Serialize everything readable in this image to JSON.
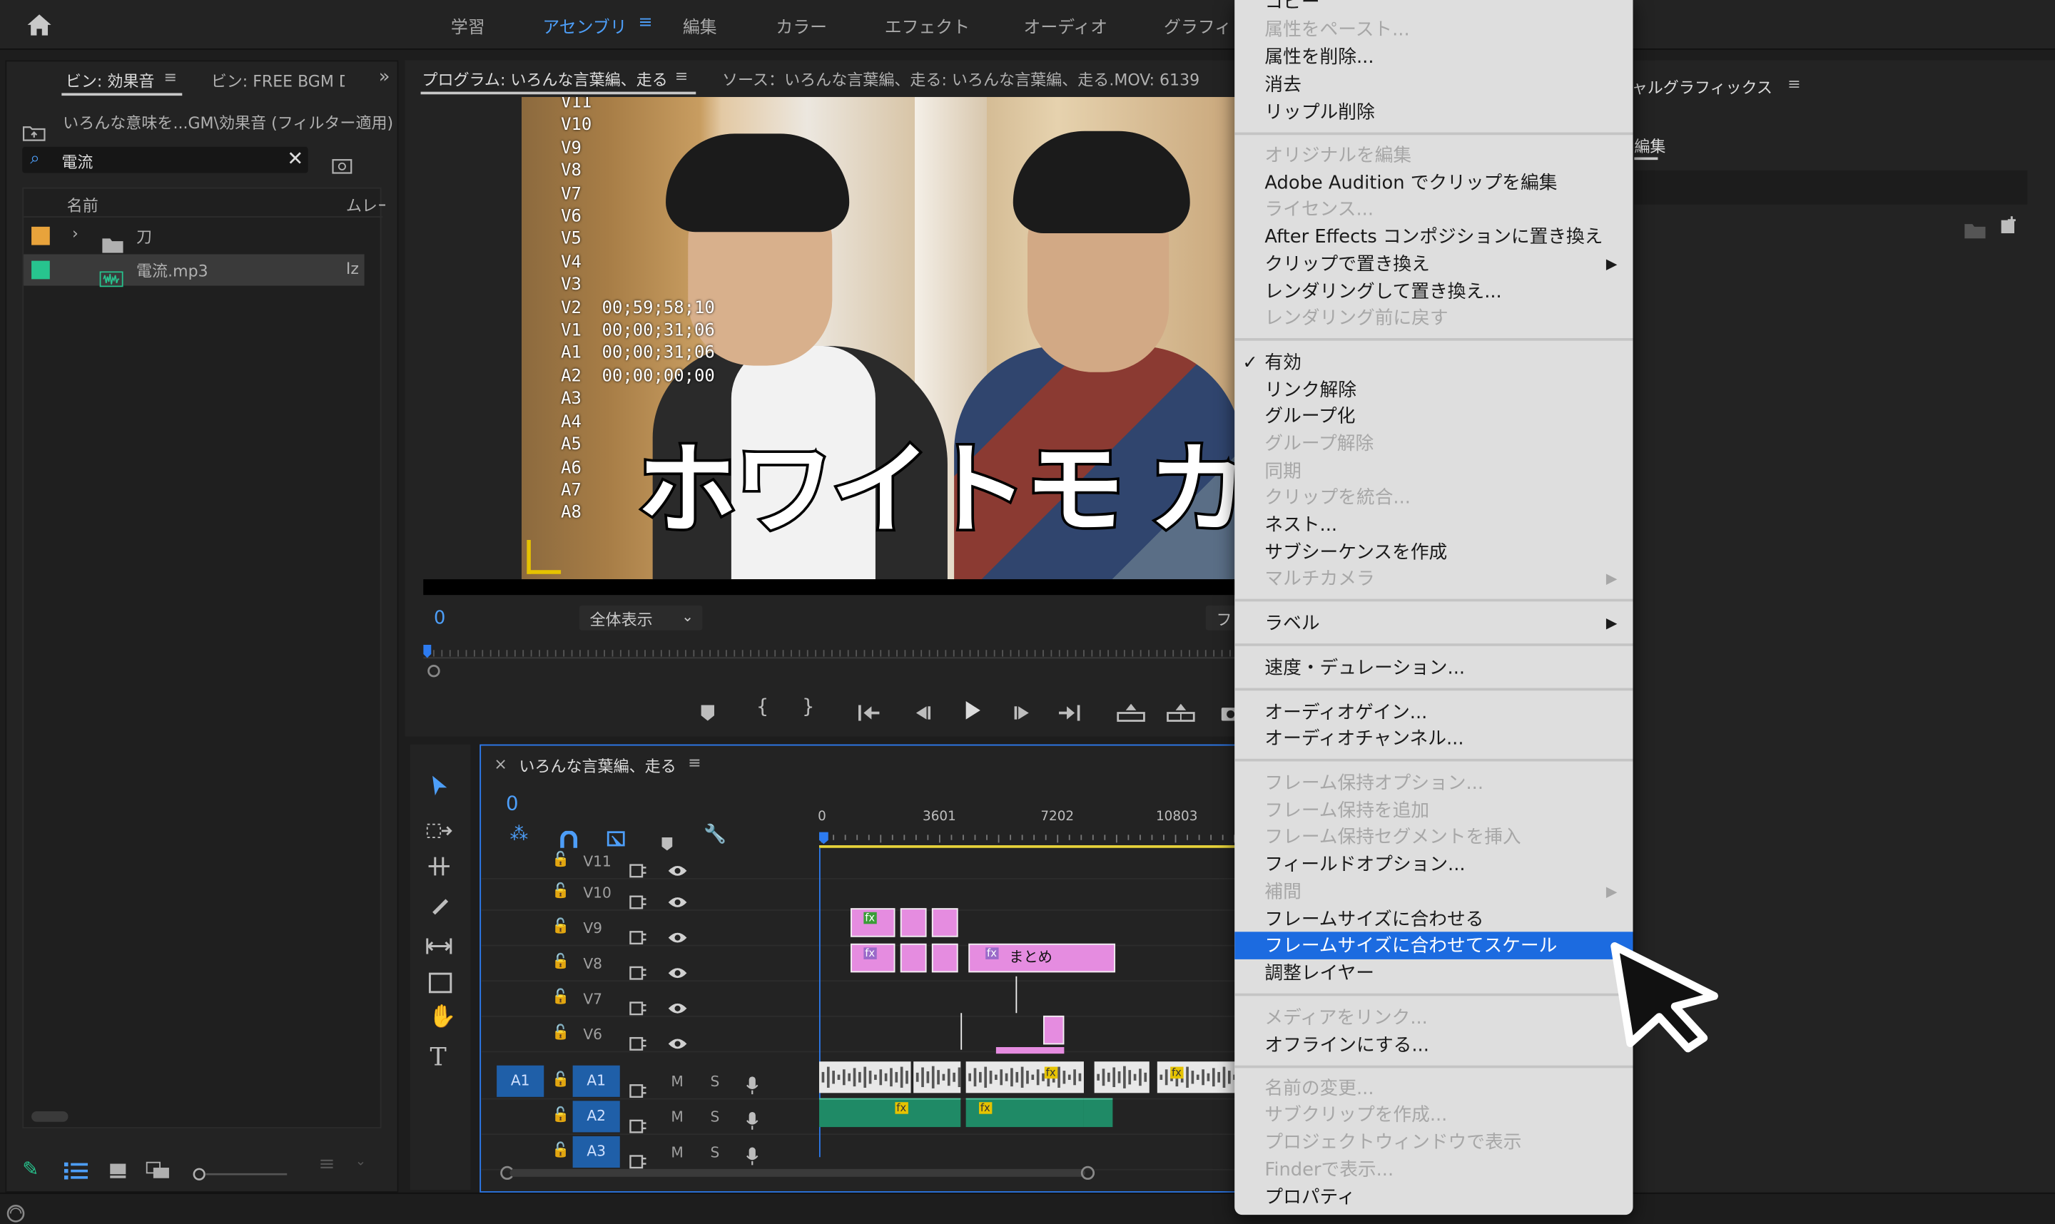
{
  "topbar": {
    "workspaces": [
      "学習",
      "アセンブリ",
      "編集",
      "カラー",
      "エフェクト",
      "オーディオ",
      "グラフィ"
    ],
    "active_index": 1
  },
  "project": {
    "tab_bin_effects": "ビン: 効果音",
    "tab_bin_bgm": "ビン: FREE BGM DO\\",
    "breadcrumb": "いろんな意味を...GM\\効果音 (フィルター適用)",
    "search_value": "電流",
    "col_name": "名前",
    "col_frame": "ムレー",
    "items": [
      {
        "label": "刀",
        "color": "#e8a33b",
        "type": "folder"
      },
      {
        "label": "電流.mp3",
        "color": "#27c48e",
        "type": "audio",
        "extra": "Iz"
      }
    ]
  },
  "program": {
    "tab_program": "プログラム: いろんな言葉編、走る",
    "tab_source": "ソース：いろんな言葉編、走る: いろんな言葉編、走る.MOV: 6139",
    "timecode": "0",
    "zoom": "全体表示",
    "fit_partial": "フ",
    "overlay_lines": [
      "V11",
      "V10",
      "V9",
      "V8",
      "V7",
      "V6",
      "V5",
      "V4",
      "V3",
      "V2  00;59;58;10",
      "V1  00;00;31;06",
      "A1  00;00;31;06",
      "A2  00;00;00;00",
      "A3",
      "A4",
      "A5",
      "A6",
      "A7",
      "A8"
    ],
    "caption": "ホワイトモ",
    "caption_partial": "カ"
  },
  "right_panel": {
    "title_partial": "ャルグラフィックス",
    "tab_partial": "編集"
  },
  "timeline": {
    "close": "×",
    "title": "いろんな言葉編、走る",
    "timecode": "0",
    "ruler": [
      "0",
      "3601",
      "7202",
      "10803"
    ],
    "video_tracks": [
      "V11",
      "V10",
      "V9",
      "V8",
      "V7",
      "V6"
    ],
    "audio_tracks": [
      {
        "src": "A1",
        "name": "A1"
      },
      {
        "src": "",
        "name": "A2"
      },
      {
        "src": "",
        "name": "A3"
      }
    ],
    "clip_label": "まとめ",
    "fx": "fx",
    "m": "M",
    "s": "S"
  },
  "context_menu": {
    "items": [
      {
        "label": "コピー",
        "enabled": true
      },
      {
        "label": "属性をペースト...",
        "enabled": false
      },
      {
        "label": "属性を削除...",
        "enabled": true
      },
      {
        "label": "消去",
        "enabled": true
      },
      {
        "label": "リップル削除",
        "enabled": true
      },
      {
        "label": "オリジナルを編集",
        "enabled": false
      },
      {
        "label": "Adobe Audition でクリップを編集",
        "enabled": true
      },
      {
        "label": "ライセンス...",
        "enabled": false
      },
      {
        "label": "After Effects コンポジションに置き換え",
        "enabled": true
      },
      {
        "label": "クリップで置き換え",
        "enabled": true,
        "submenu": true
      },
      {
        "label": "レンダリングして置き換え...",
        "enabled": true
      },
      {
        "label": "レンダリング前に戻す",
        "enabled": false
      },
      {
        "label": "有効",
        "enabled": true,
        "checked": true
      },
      {
        "label": "リンク解除",
        "enabled": true
      },
      {
        "label": "グループ化",
        "enabled": true
      },
      {
        "label": "グループ解除",
        "enabled": false
      },
      {
        "label": "同期",
        "enabled": false
      },
      {
        "label": "クリップを統合...",
        "enabled": false
      },
      {
        "label": "ネスト...",
        "enabled": true
      },
      {
        "label": "サブシーケンスを作成",
        "enabled": true
      },
      {
        "label": "マルチカメラ",
        "enabled": false,
        "submenu": true
      },
      {
        "label": "ラベル",
        "enabled": true,
        "submenu": true
      },
      {
        "label": "速度・デュレーション...",
        "enabled": true
      },
      {
        "label": "オーディオゲイン...",
        "enabled": true
      },
      {
        "label": "オーディオチャンネル...",
        "enabled": true
      },
      {
        "label": "フレーム保持オプション...",
        "enabled": false
      },
      {
        "label": "フレーム保持を追加",
        "enabled": false
      },
      {
        "label": "フレーム保持セグメントを挿入",
        "enabled": false
      },
      {
        "label": "フィールドオプション...",
        "enabled": true
      },
      {
        "label": "補間",
        "enabled": false,
        "submenu": true
      },
      {
        "label": "フレームサイズに合わせる",
        "enabled": true
      },
      {
        "label": "フレームサイズに合わせてスケール",
        "enabled": true,
        "highlighted": true
      },
      {
        "label": "調整レイヤー",
        "enabled": true
      },
      {
        "label": "メディアをリンク...",
        "enabled": false
      },
      {
        "label": "オフラインにする...",
        "enabled": true
      },
      {
        "label": "名前の変更...",
        "enabled": false
      },
      {
        "label": "サブクリップを作成...",
        "enabled": false
      },
      {
        "label": "プロジェクトウィンドウで表示",
        "enabled": false
      },
      {
        "label": "Finderで表示...",
        "enabled": false
      },
      {
        "label": "プロパティ",
        "enabled": true
      }
    ]
  },
  "colors": {
    "accent": "#4d9ef8",
    "menu_highlight": "#1c6be0",
    "playhead": "#2d7bf0",
    "work_area": "#e6d23a"
  }
}
